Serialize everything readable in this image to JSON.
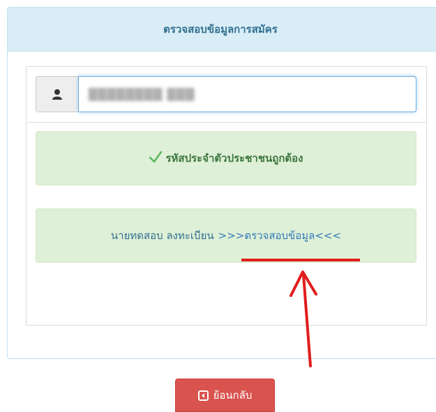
{
  "panel": {
    "title": "ตรวจสอบข้อมูลการสมัคร"
  },
  "id_input": {
    "value": "████████ ███",
    "icon": "user-icon"
  },
  "alerts": {
    "success": {
      "icon": "checkmark-icon",
      "text": "รหัสประจำตัวประชาชนถูกต้อง"
    },
    "info": {
      "name_text": "นายทดสอบ ลงทะเบียน",
      "link_text": ">>>ตรวจสอบข้อมูล<<<"
    }
  },
  "annotations": {
    "underline_color": "#e11d1d",
    "arrow_color": "#e11d1d"
  },
  "back_button": {
    "label": "ย้อนกลับ",
    "icon": "back-square-icon"
  },
  "colors": {
    "panel_heading_bg": "#d9edf7",
    "alert_bg": "#dff0d8",
    "danger": "#d9534f",
    "link": "#337ab7"
  }
}
